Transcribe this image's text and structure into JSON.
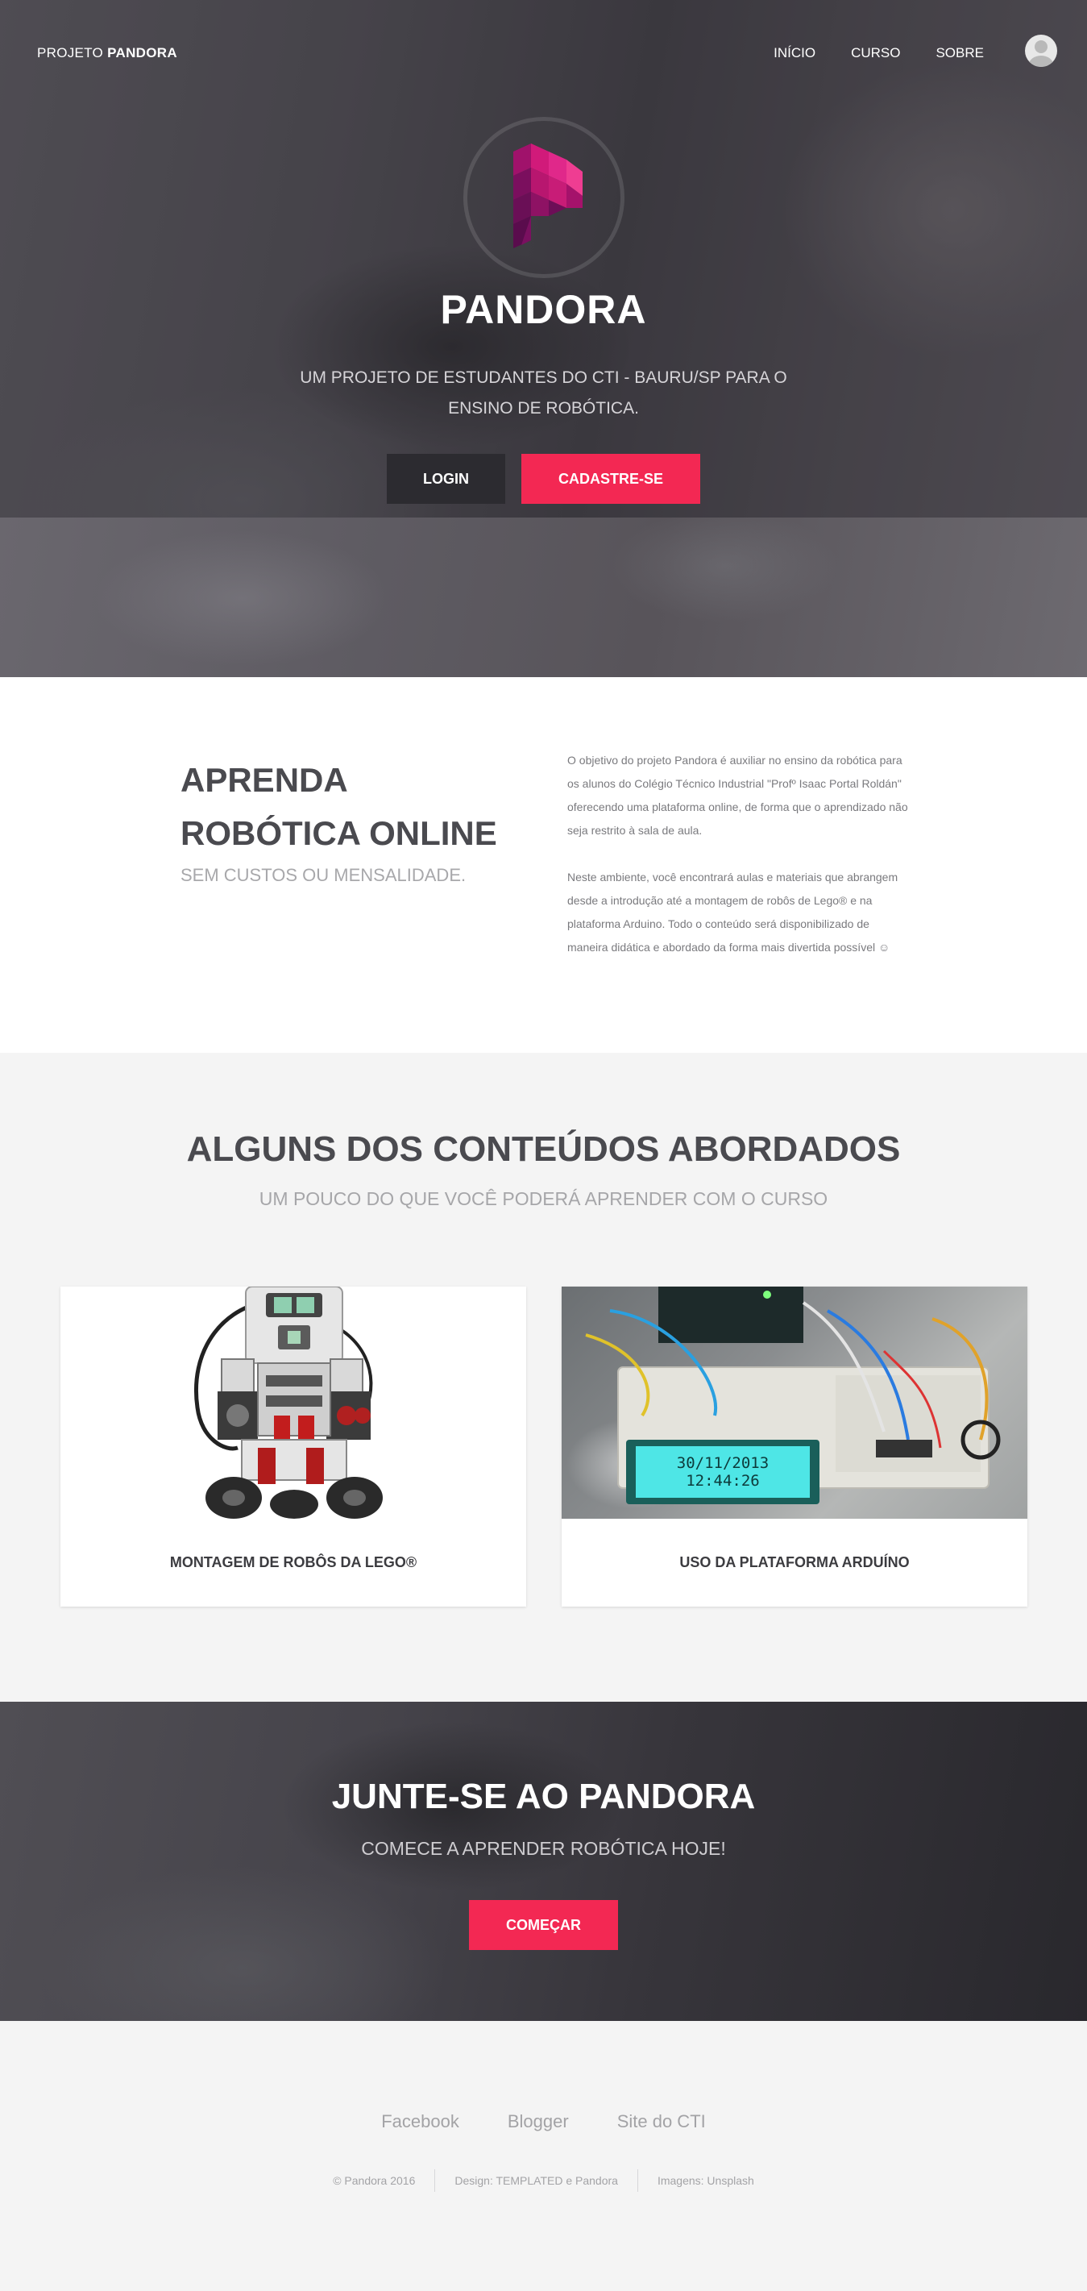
{
  "nav": {
    "brand_prefix": "PROJETO",
    "brand_name": "PANDORA",
    "links": [
      "INÍCIO",
      "CURSO",
      "SOBRE"
    ]
  },
  "hero": {
    "title": "PANDORA",
    "subtitle": "UM PROJETO DE ESTUDANTES DO CTI - BAURU/SP PARA O ENSINO DE ROBÓTICA.",
    "login_label": "LOGIN",
    "signup_label": "CADASTRE-SE"
  },
  "intro": {
    "title": "APRENDA ROBÓTICA ONLINE",
    "subtitle": "SEM CUSTOS OU MENSALIDADE.",
    "paragraph_1": "O objetivo do projeto Pandora é auxiliar no ensino da robótica para os alunos do Colégio Técnico Industrial \"Profº Isaac Portal Roldán\" oferecendo uma plataforma online, de forma que o aprendizado não seja restrito à sala de aula.",
    "paragraph_2": "Neste ambiente, você encontrará aulas e materiais que abrangem desde a introdução até a montagem de robôs de Lego® e na plataforma Arduino. Todo o conteúdo será disponibilizado de maneira didática e abordado da forma mais divertida possível ☺"
  },
  "contents": {
    "title": "ALGUNS DOS CONTEÚDOS ABORDADOS",
    "subtitle": "UM POUCO DO QUE VOCÊ PODERÁ APRENDER COM O CURSO",
    "cards": [
      {
        "label": "MONTAGEM DE ROBÔS DA LEGO®"
      },
      {
        "label": "USO DA PLATAFORMA ARDUÍNO",
        "lcd_line_1": "30/11/2013",
        "lcd_line_2": "12:44:26"
      }
    ]
  },
  "join": {
    "title": "JUNTE-SE AO PANDORA",
    "subtitle": "COMECE A APRENDER ROBÓTICA HOJE!",
    "button_label": "COMEÇAR"
  },
  "footer": {
    "links": [
      "Facebook",
      "Blogger",
      "Site do CTI"
    ],
    "copyright": "© Pandora 2016",
    "design": "Design: TEMPLATED e Pandora",
    "images": "Imagens: Unsplash"
  },
  "colors": {
    "accent": "#f32853",
    "dark_button": "#2c2b30",
    "heading": "#4a4a4f",
    "muted": "#a6a6a9"
  }
}
